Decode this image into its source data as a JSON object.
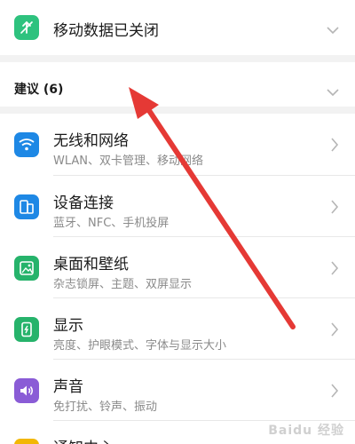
{
  "mobile_data": {
    "label": "移动数据已关闭",
    "icon": "mobile-data-off-icon",
    "color": "#2ec27e"
  },
  "suggestions": {
    "label": "建议 (6)"
  },
  "settings": [
    {
      "title": "无线和网络",
      "subtitle": "WLAN、双卡管理、移动网络",
      "icon": "wifi-icon",
      "color": "#1e88e5"
    },
    {
      "title": "设备连接",
      "subtitle": "蓝牙、NFC、手机投屏",
      "icon": "device-connect-icon",
      "color": "#1e88e5"
    },
    {
      "title": "桌面和壁纸",
      "subtitle": "杂志锁屏、主题、双屏显示",
      "icon": "wallpaper-icon",
      "color": "#26b36b"
    },
    {
      "title": "显示",
      "subtitle": "亮度、护眼模式、字体与显示大小",
      "icon": "display-icon",
      "color": "#26b36b"
    },
    {
      "title": "声音",
      "subtitle": "免打扰、铃声、振动",
      "icon": "sound-icon",
      "color": "#8a5cd6"
    },
    {
      "title": "通知中心",
      "subtitle": "",
      "icon": "notification-icon",
      "color": "#f2b705"
    }
  ],
  "watermark": {
    "text": "Baidu 经验"
  },
  "annotation": {
    "arrow_color": "#e53935"
  }
}
